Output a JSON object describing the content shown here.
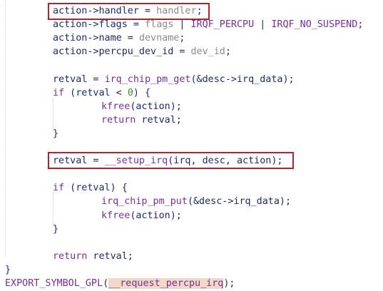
{
  "editor": {
    "lines": [
      {
        "id": "l1",
        "indent": 1,
        "tokens": [
          {
            "t": "action->handler",
            "k": "default"
          },
          {
            "t": " = ",
            "k": "default"
          },
          {
            "t": "handler",
            "k": "dimvar"
          },
          {
            "t": ";",
            "k": "punct"
          }
        ]
      },
      {
        "id": "l2",
        "indent": 1,
        "tokens": [
          {
            "t": "action->flags",
            "k": "default"
          },
          {
            "t": " = ",
            "k": "default"
          },
          {
            "t": "flags",
            "k": "dimvar"
          },
          {
            "t": " | ",
            "k": "default"
          },
          {
            "t": "IRQF_PERCPU",
            "k": "macro"
          },
          {
            "t": " | ",
            "k": "default"
          },
          {
            "t": "IRQF_NO_SUSPEND",
            "k": "macro"
          },
          {
            "t": ";",
            "k": "punct"
          }
        ]
      },
      {
        "id": "l3",
        "indent": 1,
        "tokens": [
          {
            "t": "action->name",
            "k": "default"
          },
          {
            "t": " = ",
            "k": "default"
          },
          {
            "t": "devname",
            "k": "dimvar"
          },
          {
            "t": ";",
            "k": "punct"
          }
        ]
      },
      {
        "id": "l4",
        "indent": 1,
        "tokens": [
          {
            "t": "action->percpu_dev_id",
            "k": "default"
          },
          {
            "t": " = ",
            "k": "default"
          },
          {
            "t": "dev_id",
            "k": "dimvar"
          },
          {
            "t": ";",
            "k": "punct"
          }
        ]
      },
      {
        "id": "l5",
        "indent": 1,
        "tokens": []
      },
      {
        "id": "l6",
        "indent": 1,
        "tokens": [
          {
            "t": "retval",
            "k": "default"
          },
          {
            "t": " = ",
            "k": "default"
          },
          {
            "t": "irq_chip_pm_get",
            "k": "function"
          },
          {
            "t": "(&desc->irq_data);",
            "k": "default"
          }
        ]
      },
      {
        "id": "l7",
        "indent": 1,
        "tokens": [
          {
            "t": "if",
            "k": "keyword"
          },
          {
            "t": " (retval < ",
            "k": "default"
          },
          {
            "t": "0",
            "k": "number"
          },
          {
            "t": ") {",
            "k": "default"
          }
        ]
      },
      {
        "id": "l8",
        "indent": 2,
        "tokens": [
          {
            "t": "kfree",
            "k": "function"
          },
          {
            "t": "(action);",
            "k": "default"
          }
        ]
      },
      {
        "id": "l9",
        "indent": 2,
        "tokens": [
          {
            "t": "return",
            "k": "keyword"
          },
          {
            "t": " retval;",
            "k": "default"
          }
        ]
      },
      {
        "id": "l10",
        "indent": 1,
        "tokens": [
          {
            "t": "}",
            "k": "punct"
          }
        ]
      },
      {
        "id": "l11",
        "indent": 1,
        "tokens": []
      },
      {
        "id": "l12",
        "indent": 1,
        "tokens": [
          {
            "t": "retval",
            "k": "default"
          },
          {
            "t": " = ",
            "k": "default"
          },
          {
            "t": "__setup_irq",
            "k": "function"
          },
          {
            "t": "(irq, desc, action);",
            "k": "default"
          }
        ]
      },
      {
        "id": "l13",
        "indent": 1,
        "tokens": []
      },
      {
        "id": "l14",
        "indent": 1,
        "tokens": [
          {
            "t": "if",
            "k": "keyword"
          },
          {
            "t": " (retval) {",
            "k": "default"
          }
        ]
      },
      {
        "id": "l15",
        "indent": 2,
        "tokens": [
          {
            "t": "irq_chip_pm_put",
            "k": "function"
          },
          {
            "t": "(&desc->irq_data);",
            "k": "default"
          }
        ]
      },
      {
        "id": "l16",
        "indent": 2,
        "tokens": [
          {
            "t": "kfree",
            "k": "function"
          },
          {
            "t": "(action);",
            "k": "default"
          }
        ]
      },
      {
        "id": "l17",
        "indent": 1,
        "tokens": [
          {
            "t": "}",
            "k": "punct"
          }
        ]
      },
      {
        "id": "l18",
        "indent": 1,
        "tokens": []
      },
      {
        "id": "l19",
        "indent": 1,
        "tokens": [
          {
            "t": "return",
            "k": "keyword"
          },
          {
            "t": " retval;",
            "k": "default"
          }
        ]
      },
      {
        "id": "l20",
        "indent": 0,
        "tokens": [
          {
            "t": "}",
            "k": "punct"
          }
        ]
      },
      {
        "id": "l21",
        "indent": 0,
        "tokens": [
          {
            "t": "EXPORT_SYMBOL_GPL",
            "k": "macro"
          },
          {
            "t": "(",
            "k": "default"
          },
          {
            "t": "__request_percpu_irq",
            "k": "highlight"
          },
          {
            "t": ");",
            "k": "default"
          }
        ]
      }
    ],
    "highlighted_lines": [
      "l1",
      "l12"
    ],
    "colors": {
      "background": "#ffffff",
      "default_text": "#1f2a6b",
      "keyword": "#7a2e9c",
      "macro": "#7a2e9c",
      "number": "#2f8f2f",
      "dim_variable": "#8a8a8a",
      "symbol_highlight": "#f0d7c6",
      "annotation_box": "#b3242a"
    }
  }
}
